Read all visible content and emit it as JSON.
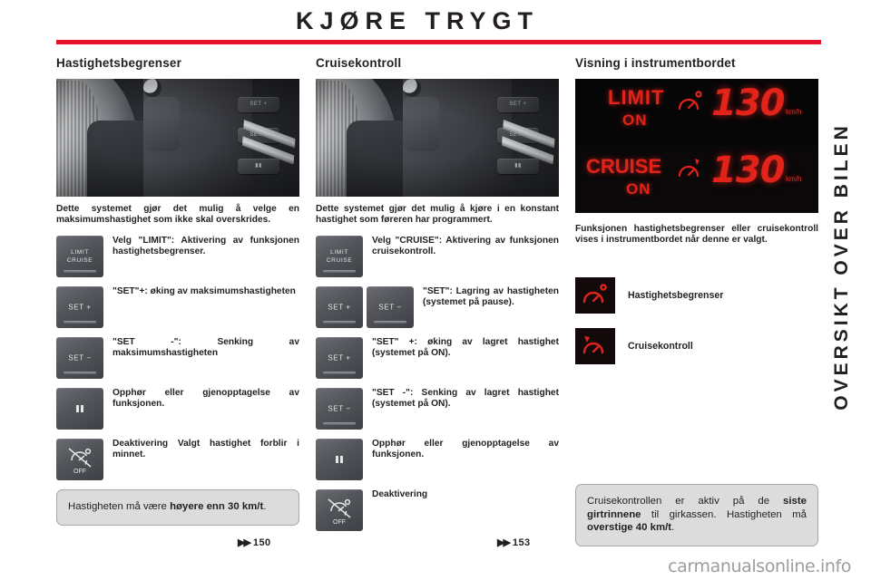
{
  "document": {
    "title": "KJØRE TRYGT",
    "side_tab": "OVERSIKT OVER BILEN",
    "watermark": "carmanualsonline.info",
    "accent_color": "#e8112d",
    "text_color": "#231f20",
    "led_color": "#e2231a"
  },
  "columns": {
    "limiter": {
      "heading": "Hastighetsbegrenser",
      "photo_name": "steering-wheel-controls-photo",
      "intro": "Dette systemet gjør det mulig å velge en maksimumshastighet som ikke skal overskrides.",
      "rows": [
        {
          "icon": "limit-cruise-button",
          "icon_label_line1": "LIMIT",
          "icon_label_line2": "CRUISE",
          "text": "Velg \"LIMIT\": Aktivering av funksjonen hastighetsbegrenser."
        },
        {
          "icon": "set-plus-button",
          "icon_label_line1": "SET +",
          "icon_label_line2": "",
          "text": "\"SET\"+: øking av maksimumshastigheten"
        },
        {
          "icon": "set-minus-button",
          "icon_label_line1": "SET −",
          "icon_label_line2": "",
          "text": "\"SET -\": Senking av maksimumshastigheten"
        },
        {
          "icon": "pause-button",
          "icon_label_line1": "",
          "icon_label_line2": "",
          "text": "Opphør eller gjenopptagelse av funksjonen."
        },
        {
          "icon": "off-button",
          "icon_label_line1": "OFF",
          "icon_label_line2": "",
          "text": "Deaktivering Valgt hastighet forblir i minnet."
        }
      ],
      "note": {
        "prefix": "Hastigheten må være ",
        "bold": "høyere enn 30 km/t",
        "suffix": "."
      },
      "page_ref": "150"
    },
    "cruise": {
      "heading": "Cruisekontroll",
      "photo_name": "steering-wheel-controls-photo",
      "intro": "Dette systemet gjør det mulig å kjøre i en konstant hastighet som føreren har programmert.",
      "rows": [
        {
          "icon": "limit-cruise-button",
          "icon_label_line1": "LIMIT",
          "icon_label_line2": "CRUISE",
          "text": "Velg \"CRUISE\": Aktivering av funksjonen cruisekontroll."
        },
        {
          "icon": "set-plus-and-set-minus-buttons",
          "icon_label_line1": "SET +",
          "icon_label_line2": "SET −",
          "text": "\"SET\": Lagring av hastigheten (systemet på pause)."
        },
        {
          "icon": "set-plus-button",
          "icon_label_line1": "SET +",
          "icon_label_line2": "",
          "text": "\"SET\" +: øking av lagret hastighet (systemet på ON)."
        },
        {
          "icon": "set-minus-button",
          "icon_label_line1": "SET −",
          "icon_label_line2": "",
          "text": "\"SET -\": Senking av lagret hastighet (systemet på ON)."
        },
        {
          "icon": "pause-button",
          "icon_label_line1": "",
          "icon_label_line2": "",
          "text": "Opphør eller gjenopptagelse av funksjonen."
        },
        {
          "icon": "off-button",
          "icon_label_line1": "OFF",
          "icon_label_line2": "",
          "text": "Deaktivering"
        }
      ],
      "page_ref": "153"
    },
    "display": {
      "heading": "Visning i instrumentbordet",
      "led": {
        "limit_word": "LIMIT",
        "limit_state": "ON",
        "limit_speed": "130",
        "limit_unit": "km/h",
        "cruise_word": "CRUISE",
        "cruise_state": "ON",
        "cruise_speed": "130",
        "cruise_unit": "km/h"
      },
      "intro": "Funksjonen hastighetsbegrenser eller cruisekontroll vises i instrumentbordet når denne er valgt.",
      "legend": [
        {
          "icon": "speed-limiter-tell-tale-icon",
          "label": "Hastighetsbegrenser"
        },
        {
          "icon": "cruise-control-tell-tale-icon",
          "label": "Cruisekontroll"
        }
      ],
      "note": {
        "part1": "Cruisekontrollen er aktiv på de ",
        "bold1": "siste girtrinnene",
        "part2": " til girkassen. Hastigheten må ",
        "bold2": "overstige 40 km/t",
        "part3": "."
      }
    }
  },
  "page_ref_arrow": "▶▶"
}
